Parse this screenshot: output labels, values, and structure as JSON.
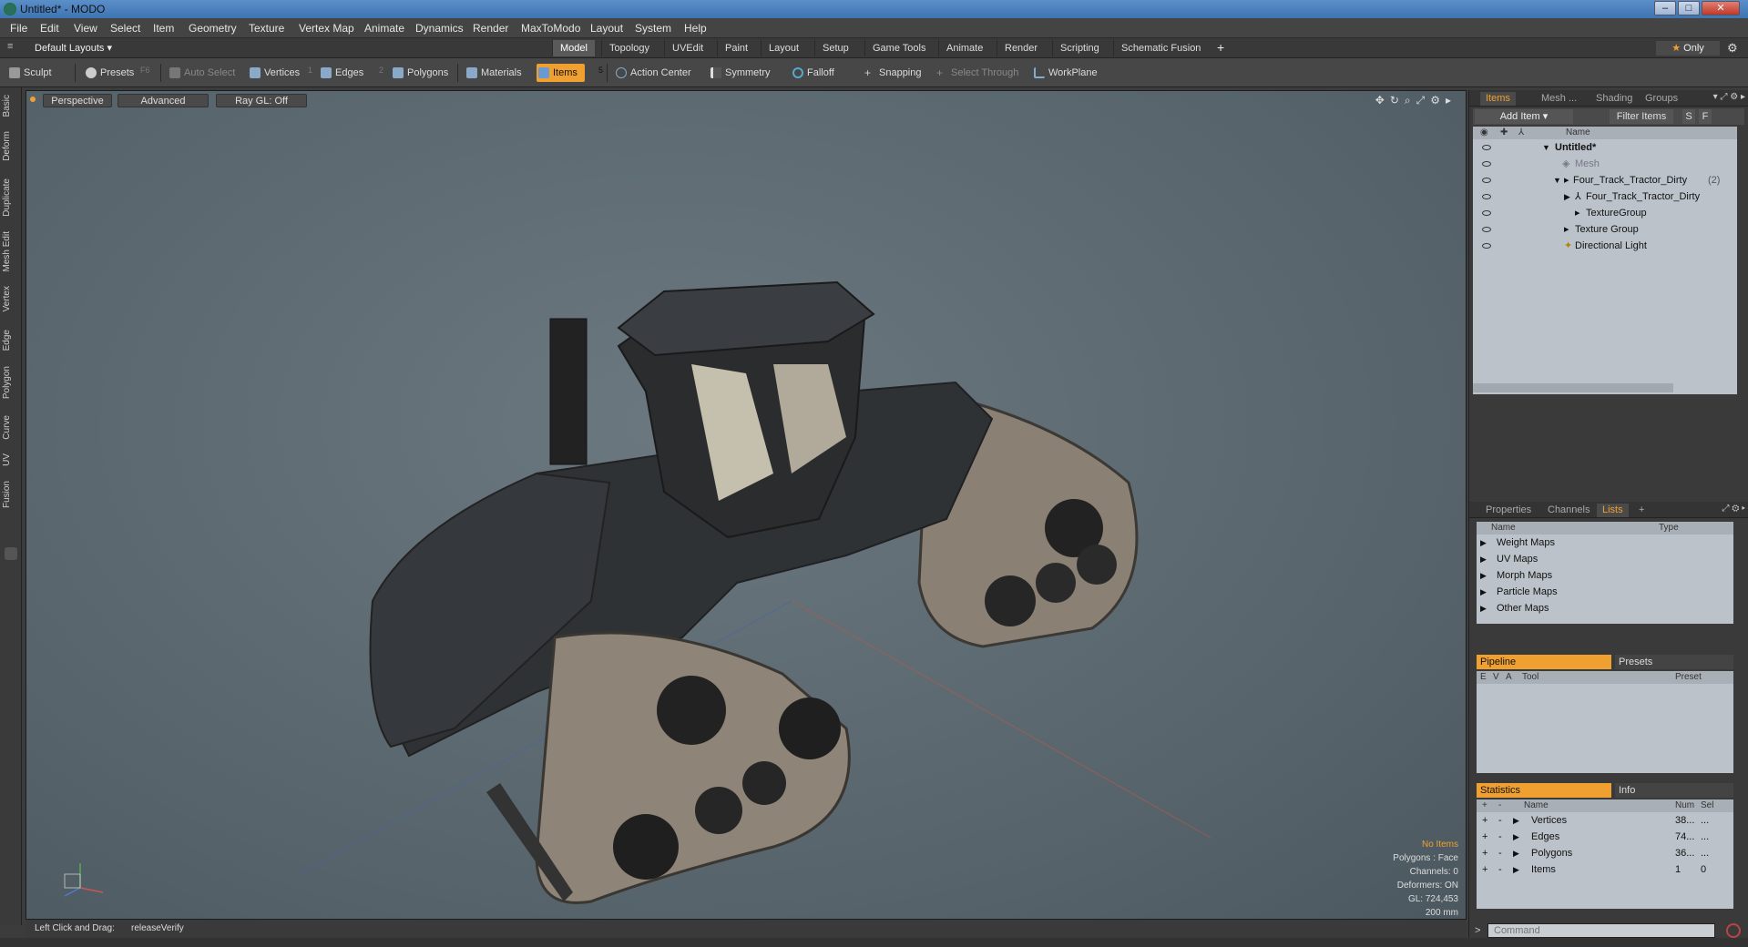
{
  "window": {
    "title": "Untitled* - MODO"
  },
  "menu": [
    "File",
    "Edit",
    "View",
    "Select",
    "Item",
    "Geometry",
    "Texture",
    "Vertex Map",
    "Animate",
    "Dynamics",
    "Render",
    "MaxToModo",
    "Layout",
    "System",
    "Help"
  ],
  "layout_selector": "Default Layouts",
  "layout_tabs": [
    "Model",
    "Topology",
    "UVEdit",
    "Paint",
    "Layout",
    "Setup",
    "Game Tools",
    "Animate",
    "Render",
    "Scripting",
    "Schematic Fusion"
  ],
  "layout_tab_add": "+",
  "only_label": "Only",
  "toolbar": {
    "sculpt": "Sculpt",
    "presets": "Presets",
    "presets_key": "F6",
    "auto_select": "Auto Select",
    "vertices": "Vertices",
    "vertices_key": "1",
    "edges": "Edges",
    "edges_key": "2",
    "polygons": "Polygons",
    "materials": "Materials",
    "items": "Items",
    "items_key": "5",
    "action_center": "Action Center",
    "symmetry": "Symmetry",
    "falloff": "Falloff",
    "snapping": "Snapping",
    "select_through": "Select Through",
    "workplane": "WorkPlane"
  },
  "left_tabs": [
    "Basic",
    "Deform",
    "Duplicate",
    "Mesh Edit",
    "Vertex",
    "Edge",
    "Polygon",
    "Curve",
    "UV",
    "Fusion"
  ],
  "viewport": {
    "view": "Perspective",
    "mode": "Advanced",
    "raygl": "Ray GL: Off",
    "info": {
      "items": "No Items",
      "polygons": "Polygons : Face",
      "channels": "Channels: 0",
      "deformers": "Deformers: ON",
      "gl": "GL: 724,453",
      "scale": "200 mm"
    }
  },
  "status": {
    "hint": "Left Click and Drag:",
    "action": "releaseVerify"
  },
  "items_panel": {
    "tabs": [
      "Items",
      "Mesh ...",
      "Shading",
      "Groups"
    ],
    "add_item": "Add Item",
    "filter": "Filter Items",
    "s_btn": "S",
    "f_btn": "F",
    "col_name": "Name",
    "tree": [
      {
        "label": "Untitled*",
        "indent": 0
      },
      {
        "label": "Mesh",
        "indent": 1
      },
      {
        "label": "Four_Track_Tractor_Dirty",
        "suffix": "(2)",
        "indent": 1
      },
      {
        "label": "Four_Track_Tractor_Dirty",
        "indent": 2
      },
      {
        "label": "TextureGroup",
        "indent": 2
      },
      {
        "label": "Texture Group",
        "indent": 1
      },
      {
        "label": "Directional Light",
        "indent": 1
      }
    ]
  },
  "props_panel": {
    "tabs": [
      "Properties",
      "Channels",
      "Lists"
    ],
    "add": "+",
    "col_name": "Name",
    "col_type": "Type",
    "rows": [
      "Weight Maps",
      "UV Maps",
      "Morph Maps",
      "Particle Maps",
      "Other Maps"
    ]
  },
  "pipeline": {
    "tab_active": "Pipeline",
    "tab_other": "Presets",
    "cols": [
      "E",
      "V",
      "A",
      "Tool",
      "Preset"
    ]
  },
  "statistics": {
    "tab_active": "Statistics",
    "tab_other": "Info",
    "cols": [
      "+",
      "-",
      "Name",
      "Num",
      "Sel"
    ],
    "rows": [
      {
        "name": "Vertices",
        "num": "38...",
        "sel": "..."
      },
      {
        "name": "Edges",
        "num": "74...",
        "sel": "..."
      },
      {
        "name": "Polygons",
        "num": "36...",
        "sel": "..."
      },
      {
        "name": "Items",
        "num": "1",
        "sel": "0"
      }
    ]
  },
  "command": {
    "placeholder": "Command",
    "prompt": ">"
  },
  "colors": {
    "accent": "#f0a030",
    "viewport_bg": "#5f6c74",
    "panel_light": "#bcc2c9"
  }
}
